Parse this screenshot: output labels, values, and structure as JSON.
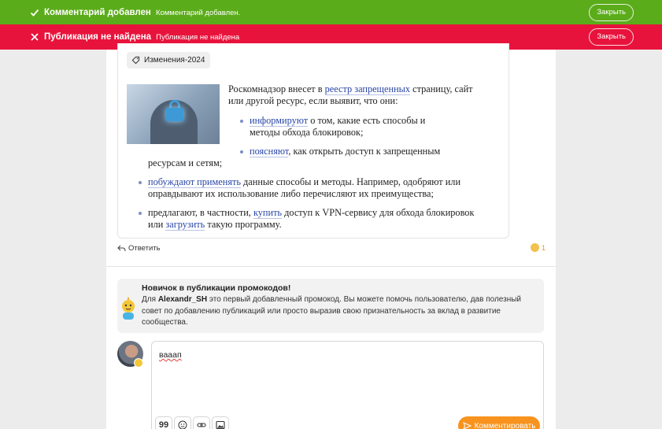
{
  "toasts": [
    {
      "type": "success",
      "title": "Комментарий добавлен",
      "message": "Комментарий добавлен.",
      "close_label": "Закрыть",
      "color": "#5bac1a"
    },
    {
      "type": "error",
      "title": "Публикация не найдена",
      "message": "Публикация не найдена",
      "close_label": "Закрыть",
      "color": "#e8133c"
    }
  ],
  "comment": {
    "tag": "Изменения-2024",
    "intro_before": "Роскомнадзор внесет в ",
    "intro_link": "реестр запрещенных",
    "intro_after": " страницу, сайт или другой ресурс, если выявит, что они:",
    "items": [
      {
        "link": "информируют",
        "text": " о том, какие есть способы и методы обхода блокировок;"
      },
      {
        "link": "поясняют",
        "text_line1": ", как открыть доступ к запрещенным",
        "text_line2": "ресурсам и сетям;"
      },
      {
        "link": "побуждают применять",
        "text_line1": " данные способы и методы. Например, одобряют или",
        "text_line2": "оправдывают их использование либо перечисляют их преимущества;"
      },
      {
        "text_before": "предлагают, в частности, ",
        "link1": "купить",
        "text_mid": " доступ к VPN-сервису для обхода блокировок",
        "text_or": "или ",
        "link2": "загрузить",
        "text_after": " такую программу."
      }
    ],
    "reply_label": "Ответить",
    "reaction_count": "1"
  },
  "promo": {
    "title": "Новичок в публикации промокодов!",
    "body_before": "Для ",
    "username": "Alexandr_SH",
    "body_after": " это первый добавленный промокод. Вы можете помочь пользователю, дав полезный совет по добавлению публикаций или просто выразив свою признательность за вклад в развитие сообщества."
  },
  "editor": {
    "text": "вааап",
    "tools": [
      "quote-icon",
      "emoji-icon",
      "link-icon",
      "image-icon"
    ],
    "quote_glyph": "99",
    "submit_label": "Комментировать",
    "accent": "#f7931e"
  }
}
